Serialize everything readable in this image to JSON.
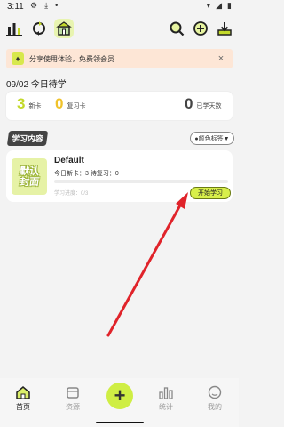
{
  "status_bar": {
    "time": "3:11"
  },
  "banner": {
    "text": "分享使用体验，免费领会员",
    "close": "×"
  },
  "summary": {
    "date_title": "09/02 今日待学",
    "new_count": "3",
    "new_label": "新卡",
    "review_count": "0",
    "review_label": "复习卡",
    "days_count": "0",
    "days_label": "已学天数"
  },
  "section": {
    "title": "学习内容",
    "color_tag_label": "●颜色标签▼"
  },
  "deck": {
    "cover_line1": "默认",
    "cover_line2": "封面",
    "name": "Default",
    "counts": "今日新卡：3 待复习：0",
    "progress_text": "学习进度：0/3",
    "progress_fraction": 0,
    "start_button": "开始学习"
  },
  "bottom_nav": {
    "home": "首页",
    "resources": "资源",
    "add": "+",
    "stats": "统计",
    "me": "我的"
  },
  "colors": {
    "accent": "#d8ef4a",
    "arrow": "#e0232a",
    "new_count": "#c3d92a",
    "review_count": "#f0c22a"
  }
}
